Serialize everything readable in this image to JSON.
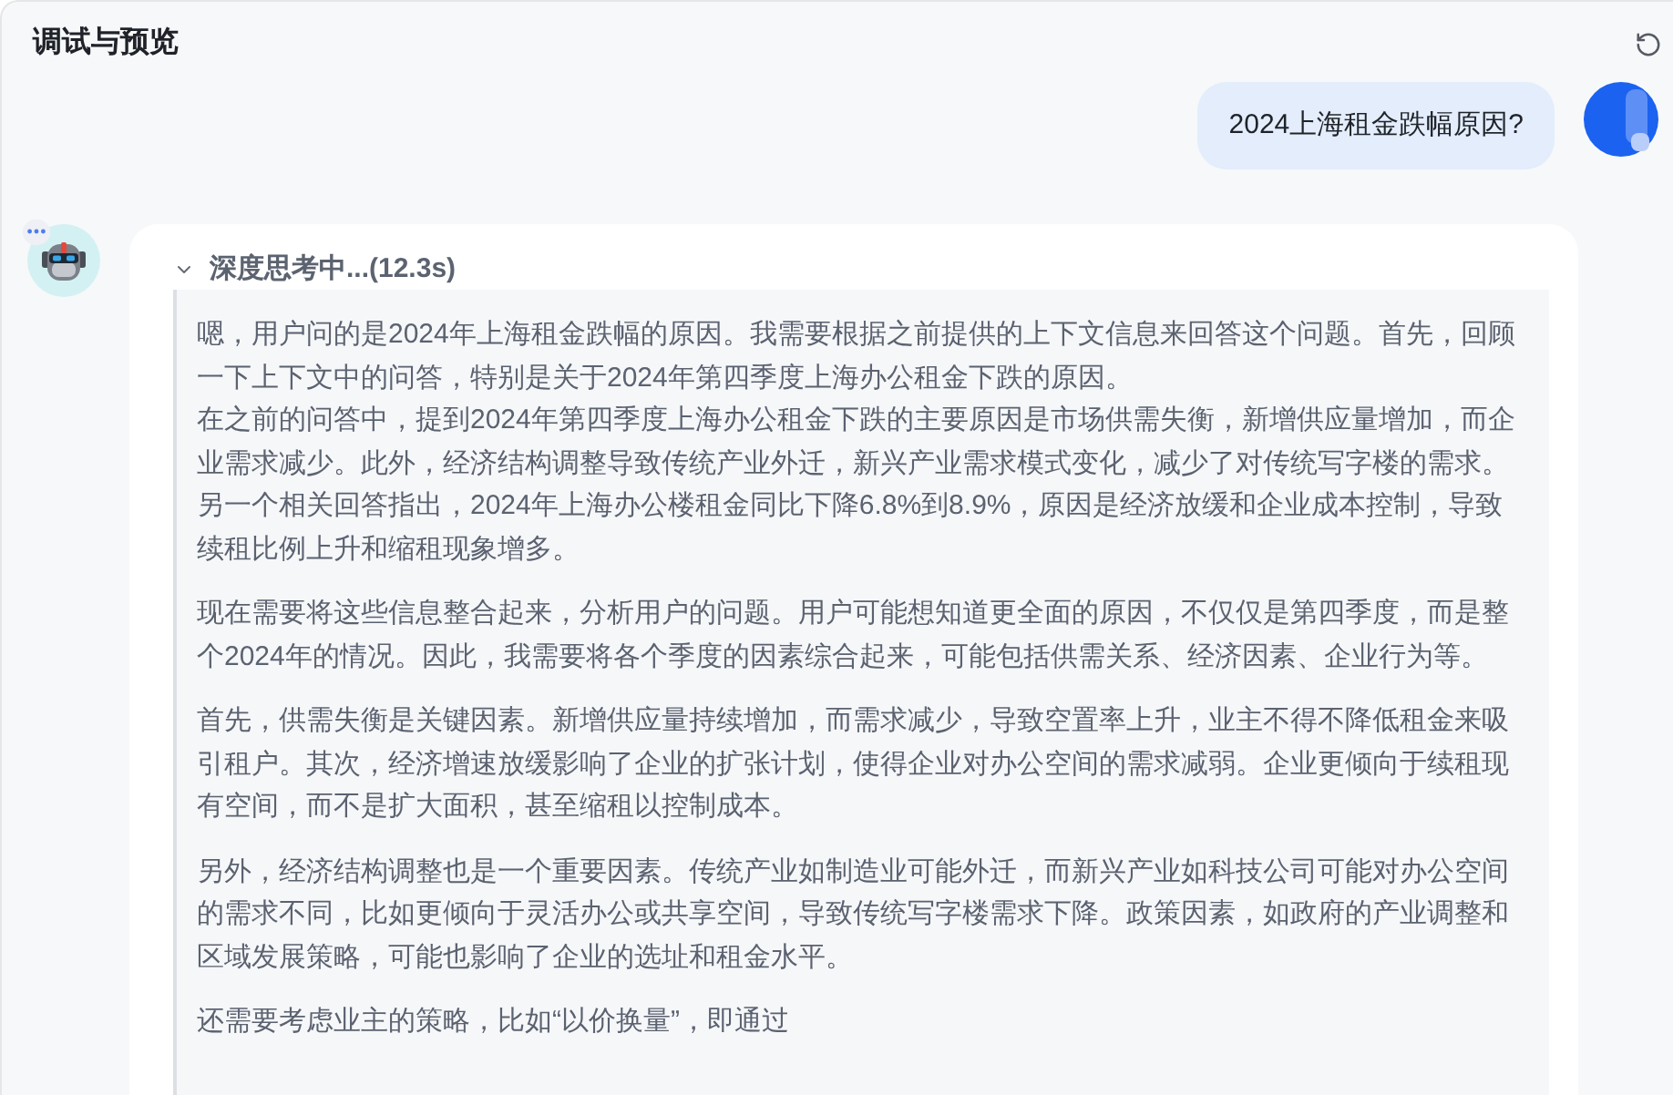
{
  "panel": {
    "title": "调试与预览"
  },
  "messages": [
    {
      "kind": "user",
      "text": "2024上海租金跌幅原因?"
    },
    {
      "kind": "assistant",
      "typing": true,
      "thinking": {
        "label": "深度思考中...(12.3s)",
        "expanded": true,
        "paragraphs": [
          {
            "lines": [
              "嗯，用户问的是2024年上海租金跌幅的原因。我需要根据之前提供的上下文信息来回答这个问题。首先，回顾一下上下文中的问答，特别是关于2024年第四季度上海办公租金下跌的原因。",
              "在之前的问答中，提到2024年第四季度上海办公租金下跌的主要原因是市场供需失衡，新增供应量增加，而企业需求减少。此外，经济结构调整导致传统产业外迁，新兴产业需求模式变化，减少了对传统写字楼的需求。另一个相关回答指出，2024年上海办公楼租金同比下降6.8%到8.9%，原因是经济放缓和企业成本控制，导致续租比例上升和缩租现象增多。"
            ]
          },
          {
            "lines": [
              "现在需要将这些信息整合起来，分析用户的问题。用户可能想知道更全面的原因，不仅仅是第四季度，而是整个2024年的情况。因此，我需要将各个季度的因素综合起来，可能包括供需关系、经济因素、企业行为等。"
            ]
          },
          {
            "lines": [
              "首先，供需失衡是关键因素。新增供应量持续增加，而需求减少，导致空置率上升，业主不得不降低租金来吸引租户。其次，经济增速放缓影响了企业的扩张计划，使得企业对办公空间的需求减弱。企业更倾向于续租现有空间，而不是扩大面积，甚至缩租以控制成本。"
            ]
          },
          {
            "lines": [
              "另外，经济结构调整也是一个重要因素。传统产业如制造业可能外迁，而新兴产业如科技公司可能对办公空间的需求不同，比如更倾向于灵活办公或共享空间，导致传统写字楼需求下降。政策因素，如政府的产业调整和区域发展策略，可能也影响了企业的选址和租金水平。"
            ]
          },
          {
            "lines": [
              "还需要考虑业主的策略，比如“以价换量”，即通过"
            ]
          }
        ]
      }
    }
  ]
}
